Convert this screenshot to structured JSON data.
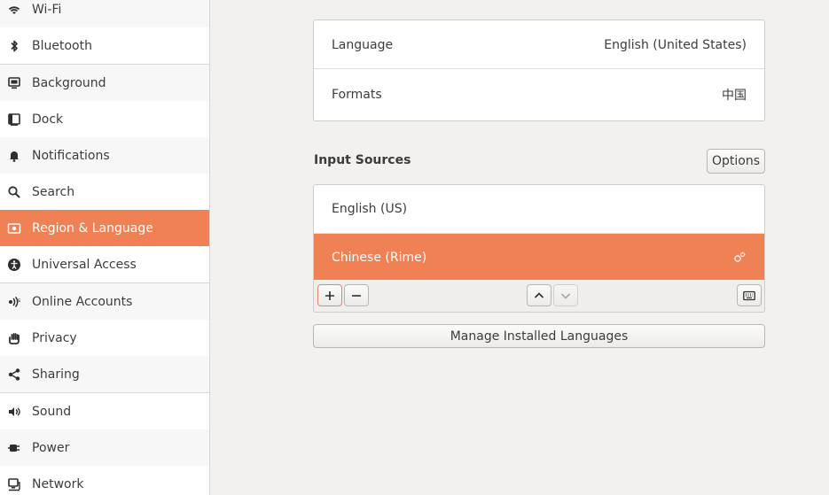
{
  "sidebar": {
    "items": [
      {
        "label": "Wi-Fi",
        "icon": "wifi-icon"
      },
      {
        "label": "Bluetooth",
        "icon": "bluetooth-icon"
      },
      {
        "label": "Background",
        "icon": "background-icon"
      },
      {
        "label": "Dock",
        "icon": "dock-icon"
      },
      {
        "label": "Notifications",
        "icon": "bell-icon"
      },
      {
        "label": "Search",
        "icon": "search-icon"
      },
      {
        "label": "Region & Language",
        "icon": "region-flag-icon"
      },
      {
        "label": "Universal Access",
        "icon": "accessibility-icon"
      },
      {
        "label": "Online Accounts",
        "icon": "online-accounts-icon"
      },
      {
        "label": "Privacy",
        "icon": "hand-icon"
      },
      {
        "label": "Sharing",
        "icon": "share-icon"
      },
      {
        "label": "Sound",
        "icon": "speaker-icon"
      },
      {
        "label": "Power",
        "icon": "power-plug-icon"
      },
      {
        "label": "Network",
        "icon": "network-icon"
      }
    ],
    "selected": "Region & Language"
  },
  "language_panel": {
    "language_label": "Language",
    "language_value": "English (United States)",
    "formats_label": "Formats",
    "formats_value": "中国"
  },
  "input_sources": {
    "title": "Input Sources",
    "options_button": "Options",
    "sources": [
      {
        "label": "English (US)"
      },
      {
        "label": "Chinese (Rime)"
      }
    ],
    "selected": "Chinese (Rime)"
  },
  "manage_button": "Manage Installed Languages",
  "colors": {
    "accent": "#f08155",
    "background": "#f2f1f0"
  }
}
